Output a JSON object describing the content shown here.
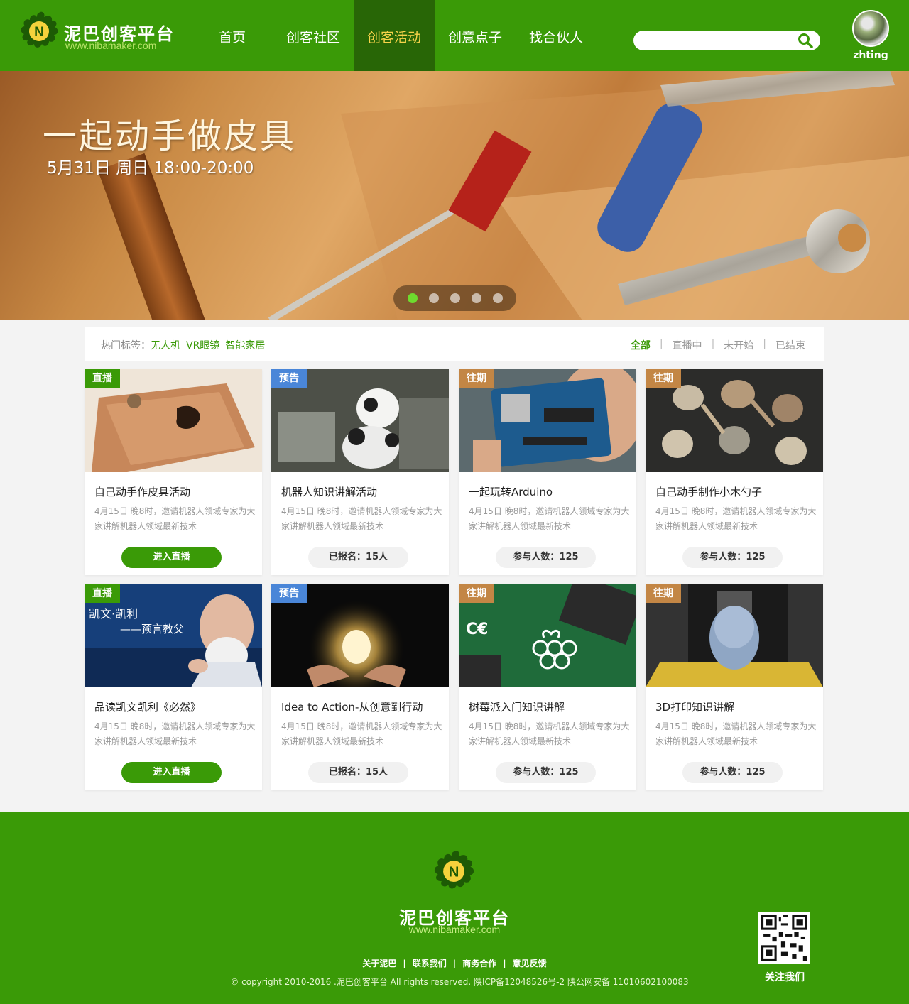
{
  "header": {
    "logo_title": "泥巴创客平台",
    "logo_url": "www.nibamaker.com",
    "nav": [
      "首页",
      "创客社区",
      "创客活动",
      "创意点子",
      "找合伙人"
    ],
    "active_nav": "创客活动",
    "search_placeholder": "",
    "username": "zhting"
  },
  "banner": {
    "title": "一起动手做皮具",
    "date": "5月31日 周日 18:00-20:00",
    "slide_count": 5,
    "active_slide": 1
  },
  "filter": {
    "tags_label": "热门标签：",
    "tags": [
      "无人机",
      "VR眼镜",
      "智能家居"
    ],
    "tabs": [
      "全部",
      "直播中",
      "未开始",
      "已结束"
    ],
    "active_tab": "全部"
  },
  "cards": [
    {
      "badge": "直播",
      "title": "自己动手作皮具活动",
      "desc": "4月15日  晚8时，邀请机器人领域专家为大家讲解机器人领域最新技术",
      "button": "进入直播"
    },
    {
      "badge": "预告",
      "title": "机器人知识讲解活动",
      "desc": "4月15日  晚8时，邀请机器人领域专家为大家讲解机器人领域最新技术",
      "button": "已报名：15人"
    },
    {
      "badge": "往期",
      "title": "一起玩转Arduino",
      "desc": "4月15日  晚8时，邀请机器人领域专家为大家讲解机器人领域最新技术",
      "button": "参与人数：125"
    },
    {
      "badge": "往期",
      "title": "自己动手制作小木勺子",
      "desc": "4月15日  晚8时，邀请机器人领域专家为大家讲解机器人领域最新技术",
      "button": "参与人数：125"
    },
    {
      "badge": "直播",
      "title": "品读凯文凯利《必然》",
      "desc": "4月15日  晚8时，邀请机器人领域专家为大家讲解机器人领域最新技术",
      "button": "进入直播",
      "thumb_text1": "凯文·凯利",
      "thumb_text2": "——预言教父"
    },
    {
      "badge": "预告",
      "title": "Idea to Action-从创意到行动",
      "desc": "4月15日  晚8时，邀请机器人领域专家为大家讲解机器人领域最新技术",
      "button": "已报名：15人"
    },
    {
      "badge": "往期",
      "title": "树莓派入门知识讲解",
      "desc": "4月15日  晚8时，邀请机器人领域专家为大家讲解机器人领域最新技术",
      "button": "参与人数：125"
    },
    {
      "badge": "往期",
      "title": "3D打印知识讲解",
      "desc": "4月15日  晚8时，邀请机器人领域专家为大家讲解机器人领域最新技术",
      "button": "参与人数：125"
    }
  ],
  "footer": {
    "title": "泥巴创客平台",
    "url": "www.nibamaker.com",
    "links": [
      "关于泥巴",
      "联系我们",
      "商务合作",
      "意见反馈"
    ],
    "copyright": "© copyright 2010-2016 .泥巴创客平台 All rights reserved. 陕ICP备12048526号-2 陕公网安备 11010602100083",
    "qr_label": "关注我们"
  },
  "colors": {
    "brand_green": "#3a9a07",
    "nav_active_bg": "#286606",
    "nav_active_text": "#f7d34a",
    "badge_preview": "#4a86d8",
    "badge_past": "#c38645"
  }
}
